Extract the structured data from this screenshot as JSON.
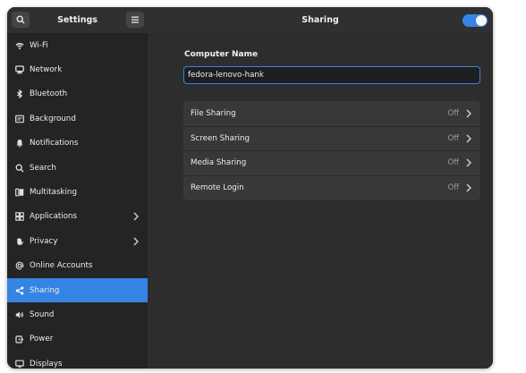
{
  "sidebar": {
    "title": "Settings",
    "items": [
      {
        "label": "Wi-Fi",
        "icon": "wifi-icon"
      },
      {
        "label": "Network",
        "icon": "network-icon"
      },
      {
        "label": "Bluetooth",
        "icon": "bluetooth-icon"
      },
      {
        "label": "Background",
        "icon": "background-icon"
      },
      {
        "label": "Notifications",
        "icon": "bell-icon"
      },
      {
        "label": "Search",
        "icon": "search-icon"
      },
      {
        "label": "Multitasking",
        "icon": "multitasking-icon"
      },
      {
        "label": "Applications",
        "icon": "grid-icon"
      },
      {
        "label": "Privacy",
        "icon": "hand-icon"
      },
      {
        "label": "Online Accounts",
        "icon": "at-icon"
      },
      {
        "label": "Sharing",
        "icon": "share-icon"
      },
      {
        "label": "Sound",
        "icon": "speaker-icon"
      },
      {
        "label": "Power",
        "icon": "power-icon"
      },
      {
        "label": "Displays",
        "icon": "display-icon"
      }
    ]
  },
  "header": {
    "title": "Sharing",
    "toggle_on": true
  },
  "computer_name": {
    "label": "Computer Name",
    "value": "fedora-lenovo-hank"
  },
  "sharing_options": [
    {
      "label": "File Sharing",
      "status": "Off"
    },
    {
      "label": "Screen Sharing",
      "status": "Off"
    },
    {
      "label": "Media Sharing",
      "status": "Off"
    },
    {
      "label": "Remote Login",
      "status": "Off"
    }
  ],
  "colors": {
    "accent": "#3584e4",
    "sidebar_bg": "#242424",
    "main_bg": "#2d2d2d",
    "list_bg": "#383838"
  }
}
